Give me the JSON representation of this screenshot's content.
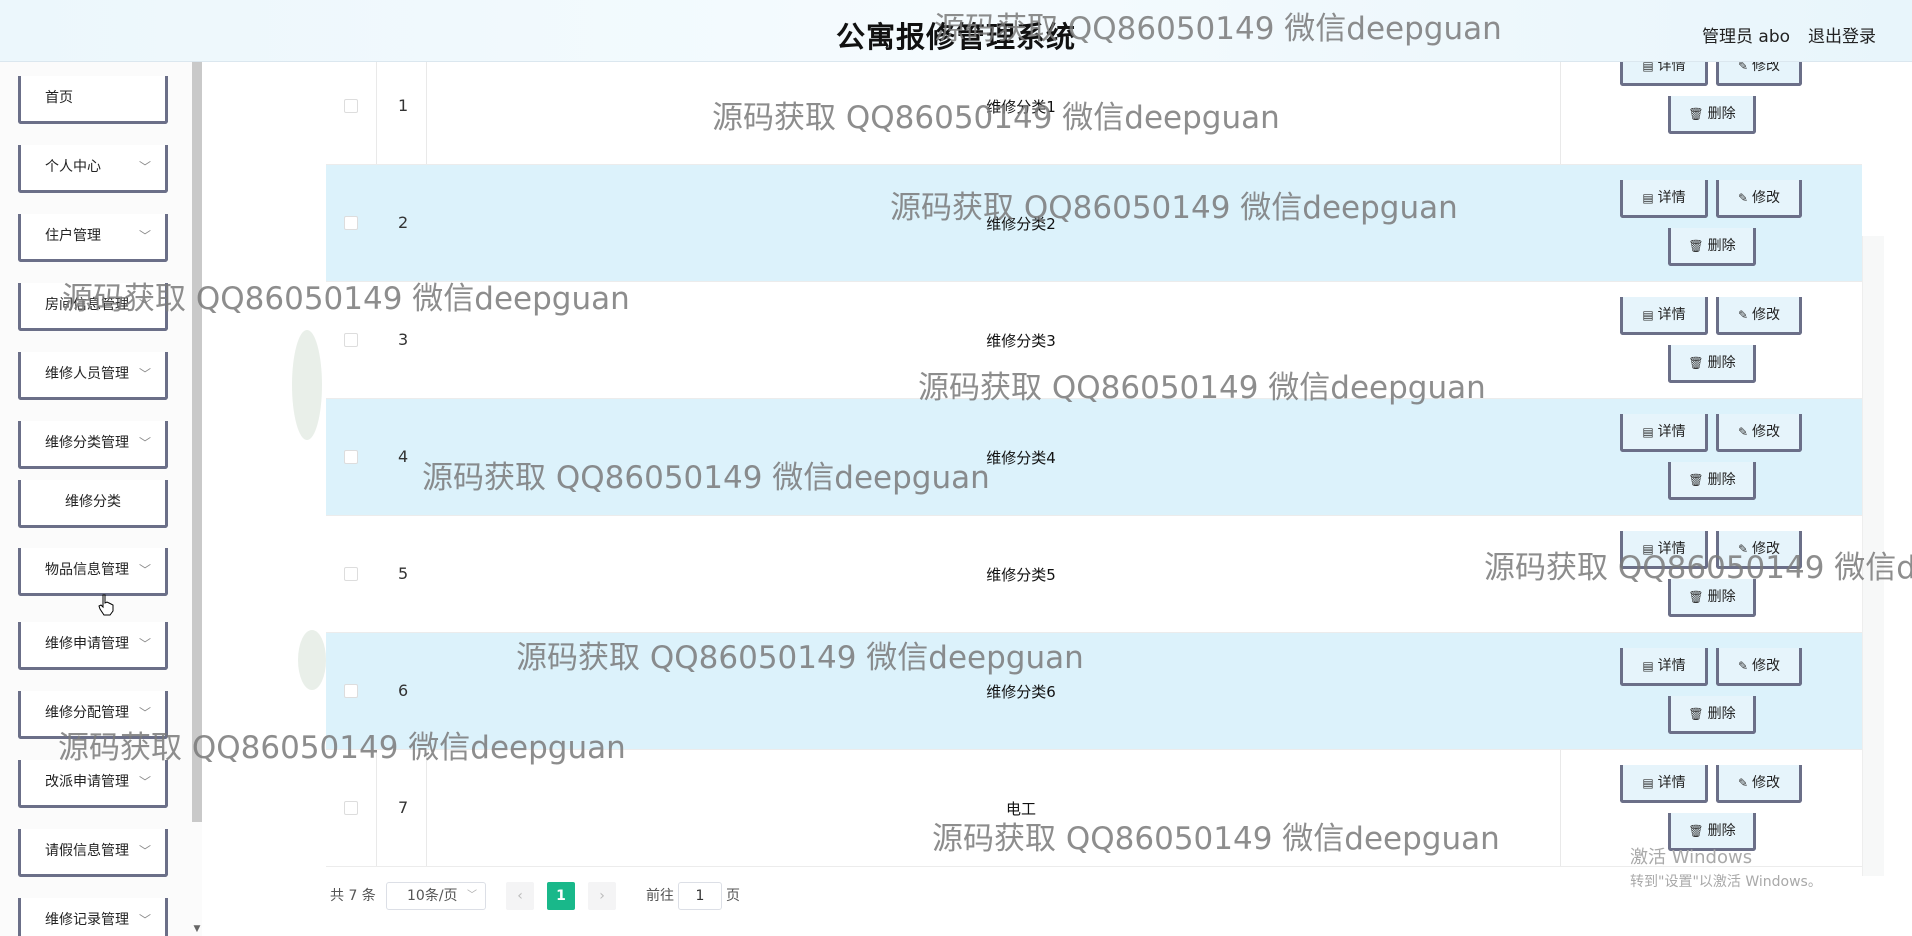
{
  "header": {
    "title": "公寓报修管理系统",
    "user_label": "管理员 abo",
    "logout_label": "退出登录"
  },
  "sidebar": {
    "items": [
      {
        "label": "首页",
        "has_submenu": false
      },
      {
        "label": "个人中心",
        "has_submenu": true
      },
      {
        "label": "住户管理",
        "has_submenu": true
      },
      {
        "label": "房间信息管理",
        "has_submenu": true
      },
      {
        "label": "维修人员管理",
        "has_submenu": true
      },
      {
        "label": "维修分类管理",
        "has_submenu": true,
        "expanded": true
      },
      {
        "label": "维修分类",
        "is_child": true
      },
      {
        "label": "物品信息管理",
        "has_submenu": true
      },
      {
        "label": "维修申请管理",
        "has_submenu": true
      },
      {
        "label": "维修分配管理",
        "has_submenu": true
      },
      {
        "label": "改派申请管理",
        "has_submenu": true
      },
      {
        "label": "请假信息管理",
        "has_submenu": true
      },
      {
        "label": "维修记录管理",
        "has_submenu": true
      }
    ]
  },
  "table": {
    "rows": [
      {
        "index": "1",
        "name": "维修分类1"
      },
      {
        "index": "2",
        "name": "维修分类2"
      },
      {
        "index": "3",
        "name": "维修分类3"
      },
      {
        "index": "4",
        "name": "维修分类4"
      },
      {
        "index": "5",
        "name": "维修分类5"
      },
      {
        "index": "6",
        "name": "维修分类6"
      },
      {
        "index": "7",
        "name": "电工"
      }
    ],
    "actions": {
      "detail": "详情",
      "edit": "修改",
      "delete": "删除"
    }
  },
  "pagination": {
    "total": "共 7 条",
    "page_size": "10条/页",
    "current_page": "1",
    "goto_label": "前往",
    "goto_value": "1",
    "page_unit": "页"
  },
  "os_notice": {
    "line1": "激活 Windows",
    "line2": "转到\"设置\"以激活 Windows。"
  },
  "watermark_text": "源码获取 QQ86050149 微信deepguan",
  "colors": {
    "accent": "#19b88a",
    "row_highlight": "#dcf2fb",
    "button_border": "#6b6f88"
  }
}
